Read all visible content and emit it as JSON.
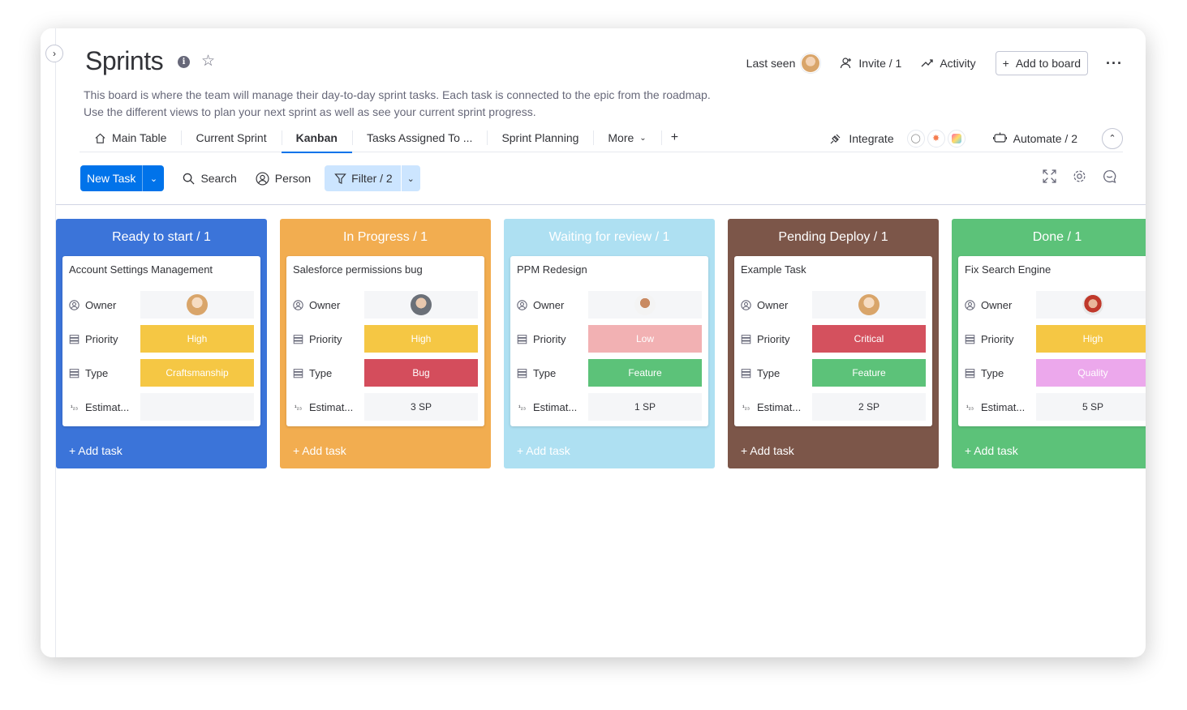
{
  "header": {
    "title": "Sprints",
    "description_line1": "This board is where the team will manage their day-to-day sprint tasks. Each task is connected to the epic from the roadmap.",
    "description_line2": "Use the different views to plan your next sprint as well as see your current sprint progress.",
    "last_seen": "Last seen",
    "invite": "Invite / 1",
    "activity": "Activity",
    "add_to_board": "Add to board"
  },
  "tabs": {
    "main_table": "Main Table",
    "current_sprint": "Current Sprint",
    "kanban": "Kanban",
    "tasks_assigned": "Tasks Assigned To ...",
    "sprint_planning": "Sprint Planning",
    "more": "More",
    "add": "+",
    "integrate": "Integrate",
    "automate": "Automate / 2"
  },
  "toolbar": {
    "new_task": "New Task",
    "search": "Search",
    "person": "Person",
    "filter": "Filter / 2"
  },
  "labels": {
    "owner": "Owner",
    "priority": "Priority",
    "type": "Type",
    "estimate": "Estimat...",
    "add_task": "+ Add task"
  },
  "columns": [
    {
      "title": "Ready to start / 1",
      "color": "#3b74d9",
      "task": "Account Settings Management",
      "priority": "High",
      "priority_color": "#f5c744",
      "type": "Craftsmanship",
      "type_color": "#f5c744",
      "estimate": ""
    },
    {
      "title": "In Progress / 1",
      "color": "#f2ad50",
      "task": "Salesforce permissions bug",
      "priority": "High",
      "priority_color": "#f5c744",
      "type": "Bug",
      "type_color": "#d44d5c",
      "estimate": "3 SP"
    },
    {
      "title": "Waiting for review / 1",
      "color": "#aee0f2",
      "task": "PPM Redesign",
      "priority": "Low",
      "priority_color": "#f2b1b3",
      "type": "Feature",
      "type_color": "#5cc279",
      "estimate": "1 SP"
    },
    {
      "title": "Pending Deploy / 1",
      "color": "#7c5649",
      "task": "Example Task",
      "priority": "Critical",
      "priority_color": "#d4515e",
      "type": "Feature",
      "type_color": "#5cc279",
      "estimate": "2 SP"
    },
    {
      "title": "Done / 1",
      "color": "#5cc279",
      "task": "Fix Search Engine",
      "priority": "High",
      "priority_color": "#f5c744",
      "type": "Quality",
      "type_color": "#eca8ec",
      "estimate": "5 SP"
    }
  ],
  "icons": {
    "collapse": "chevron-right-icon",
    "info": "info-icon",
    "star": "star-icon",
    "home": "home-icon",
    "search": "search-icon",
    "person": "person-icon",
    "filter": "filter-icon",
    "expand": "fullscreen-icon",
    "settings": "gear-icon",
    "chat": "chat-icon"
  }
}
